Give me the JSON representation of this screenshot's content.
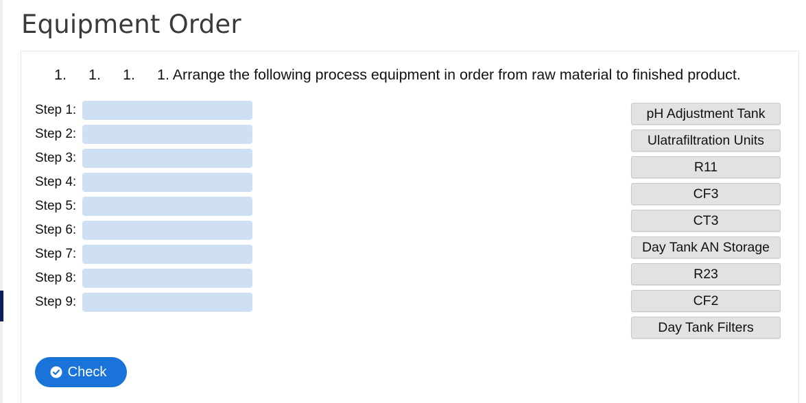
{
  "page": {
    "title": "Equipment Order"
  },
  "question": {
    "list_markers": [
      "1.",
      "1.",
      "1."
    ],
    "text": "1. Arrange the following process equipment in order from raw material to finished product."
  },
  "steps": [
    {
      "label": "Step 1:",
      "value": ""
    },
    {
      "label": "Step 2:",
      "value": ""
    },
    {
      "label": "Step 3:",
      "value": ""
    },
    {
      "label": "Step 4:",
      "value": ""
    },
    {
      "label": "Step 5:",
      "value": ""
    },
    {
      "label": "Step 6:",
      "value": ""
    },
    {
      "label": "Step 7:",
      "value": ""
    },
    {
      "label": "Step 8:",
      "value": ""
    },
    {
      "label": "Step 9:",
      "value": ""
    }
  ],
  "options": [
    "pH Adjustment Tank",
    "Ulatrafiltration Units",
    "R11",
    "CF3",
    "CT3",
    "Day Tank AN Storage",
    "R23",
    "CF2",
    "Day Tank Filters"
  ],
  "check_button": {
    "label": "Check",
    "icon": "check-circle-icon"
  },
  "colors": {
    "drop_zone": "#cfe0f5",
    "chip": "#e2e2e2",
    "button": "#1a73d9",
    "marker": "#0c1f5a"
  }
}
